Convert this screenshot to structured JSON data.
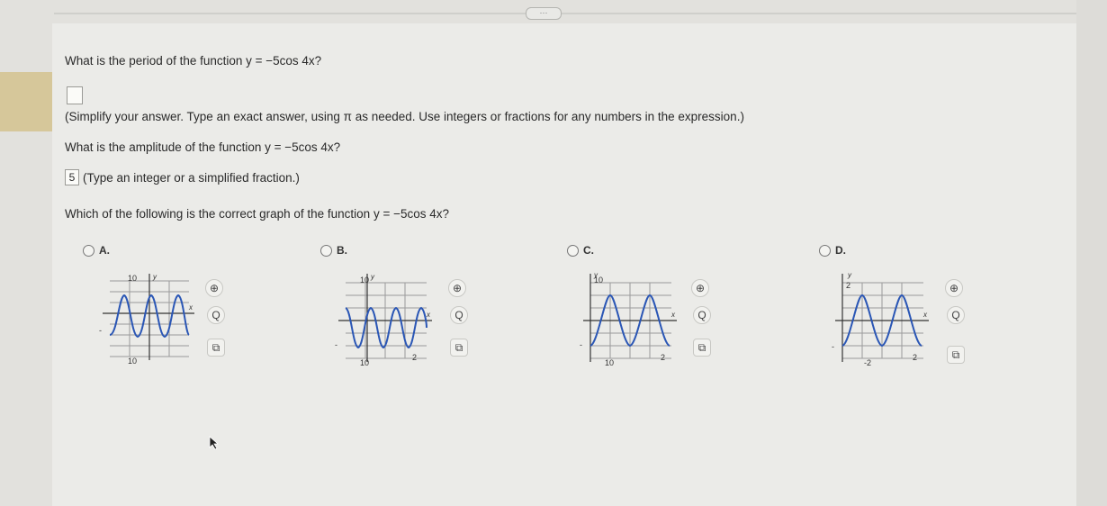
{
  "header": {
    "dots": "···"
  },
  "question1": {
    "prefix": "What is the period of the function",
    "function": "y = −5cos 4x?",
    "instruction": "(Simplify your answer. Type an exact answer, using π as needed. Use integers or fractions for any numbers in the expression.)"
  },
  "question2": {
    "prefix": "What is the amplitude of the function",
    "function": "y = −5cos 4x?",
    "answer": "5",
    "instruction": "(Type an integer or a simplified fraction.)"
  },
  "question3": {
    "prefix": "Which of the following is the correct graph of the function",
    "function": "y = −5cos 4x?"
  },
  "options": [
    {
      "label": "A.",
      "y_top": "10",
      "y_bottom": "10",
      "x_neg": "-",
      "x_label": "x",
      "y_label": "y"
    },
    {
      "label": "B.",
      "y_top": "10",
      "y_bottom": "10",
      "x_neg": "-",
      "x_right": "2",
      "x_label": "x",
      "y_label": "y"
    },
    {
      "label": "C.",
      "y_top": "10",
      "y_bottom": "10",
      "x_neg": "-",
      "x_right": "2",
      "x_label": "x",
      "y_label": "y"
    },
    {
      "label": "D.",
      "y_top": "2",
      "y_bottom": "-2",
      "x_neg": "-",
      "x_right": "2",
      "x_label": "x",
      "y_label": "y"
    }
  ],
  "tools": {
    "zoom_in": "⊕",
    "zoom_out": "Q",
    "popout": "⧉"
  },
  "colors": {
    "curve": "#2a56b5",
    "grid": "#9a9a9a",
    "axis": "#333333",
    "accent_bar": "#d6c79a"
  }
}
